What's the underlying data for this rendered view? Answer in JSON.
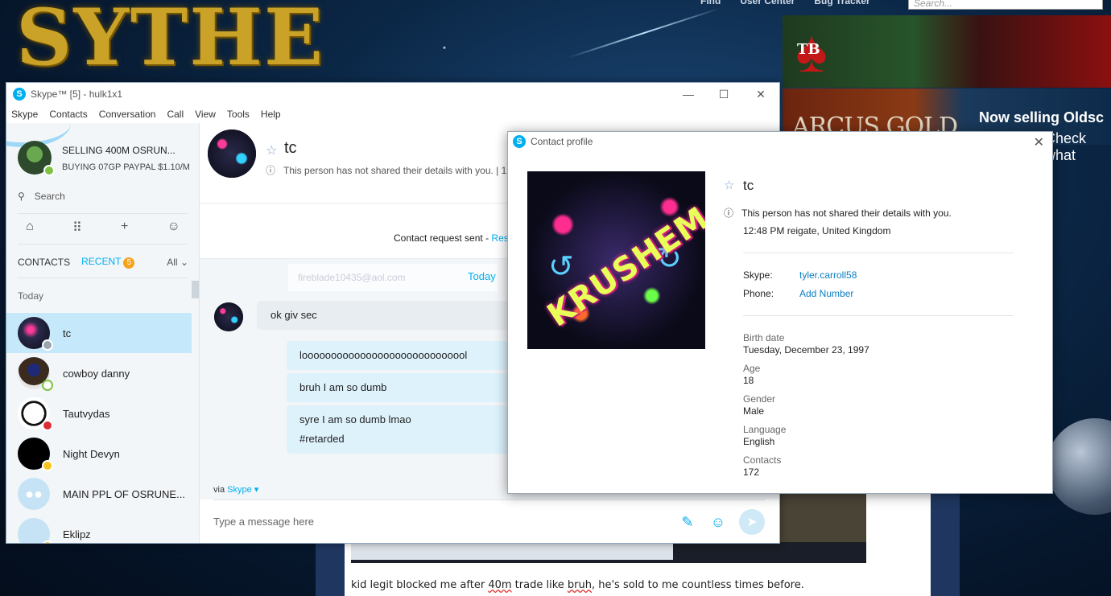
{
  "background": {
    "site_logo": "SYTHE",
    "nav": [
      "Find",
      "User Center",
      "Bug Tracker"
    ],
    "search_placeholder": "Search...",
    "ad1_text": "TB",
    "ad2_text": "ARCUS GOLD",
    "ad2_tagline": "Now selling Oldsc",
    "ad2_tagline2": "Check what",
    "forum_text_before": "kid legit blocked me after ",
    "forum_text_mid1": "40m",
    "forum_text_mid2": " trade like ",
    "forum_text_mid3": "bruh",
    "forum_text_after": ", he's sold to me countless times before."
  },
  "skype": {
    "title": "Skype™ [5] - hulk1x1",
    "menu": [
      "Skype",
      "Contacts",
      "Conversation",
      "Call",
      "View",
      "Tools",
      "Help"
    ],
    "me": {
      "name": "SELLING 400M OSRUN...",
      "mood": "BUYING 07GP PAYPAL $1.10/M"
    },
    "search_label": "Search",
    "tabs": {
      "contacts": "CONTACTS",
      "recent": "RECENT",
      "recent_count": "5",
      "all": "All"
    },
    "group": "Today",
    "contacts": [
      {
        "name": "tc",
        "status": "#9aa5ad"
      },
      {
        "name": "cowboy danny",
        "status": "#7dc242"
      },
      {
        "name": "Tautvydas",
        "status": "#e02b35"
      },
      {
        "name": "Night Devyn",
        "status": "#f7c31b"
      },
      {
        "name": "MAIN PPL OF OSRUNE...",
        "status": ""
      },
      {
        "name": "Eklipz",
        "status": "#f7c31b"
      }
    ],
    "conversation": {
      "name": "tc",
      "sub": "This person has not shared their details with you.  |  1",
      "request": "Contact request sent - ",
      "request_link": "Rese",
      "faded_email": "fireblade10435@aol.com",
      "today": "Today",
      "incoming": "ok giv sec",
      "outgoing": [
        "looooooooooooooooooooooooooool",
        "bruh I am so dumb",
        "syre I am so dumb lmao",
        "#retarded"
      ],
      "via": "via ",
      "via_link": "Skype",
      "composer_placeholder": "Type a message here"
    }
  },
  "profile": {
    "title": "Contact profile",
    "picture_word": "KRUSHEM",
    "name": "tc",
    "info": "This person has not shared their details with you.",
    "time": "12:48 PM reigate, United Kingdom",
    "skype_label": "Skype:",
    "skype_value": "tyler.carroll58",
    "phone_label": "Phone:",
    "phone_value": "Add Number",
    "fields": [
      {
        "key": "Birth date",
        "value": "Tuesday, December 23, 1997"
      },
      {
        "key": "Age",
        "value": "18"
      },
      {
        "key": "Gender",
        "value": "Male"
      },
      {
        "key": "Language",
        "value": "English"
      },
      {
        "key": "Contacts",
        "value": "172"
      }
    ]
  }
}
